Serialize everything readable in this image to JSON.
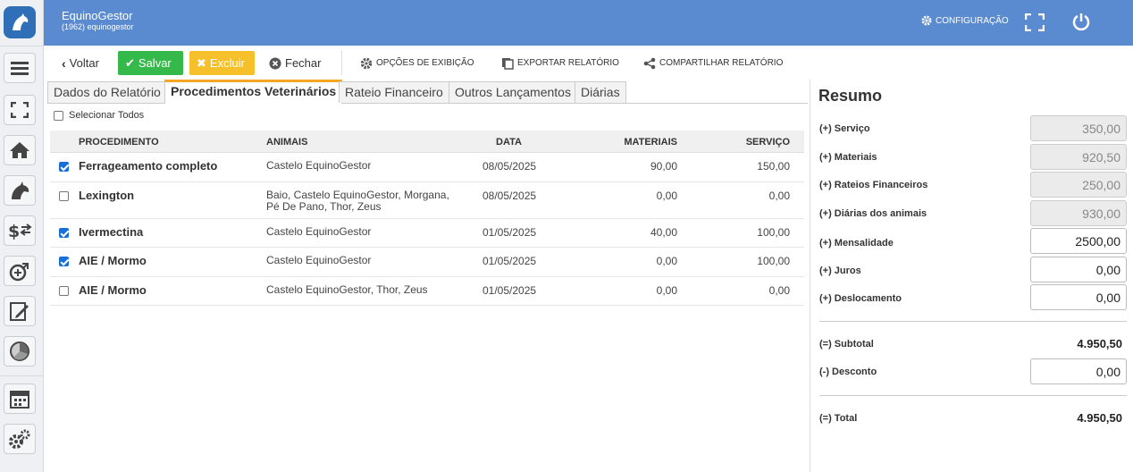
{
  "app": {
    "title": "EquinoGestor",
    "subtitle": "(1962) equinogestor"
  },
  "header": {
    "config_label": "CONFIGURAÇÃO"
  },
  "toolbar": {
    "back": "Voltar",
    "save": "Salvar",
    "delete": "Excluir",
    "close": "Fechar",
    "display_options": "OPÇÕES DE EXIBIÇÃO",
    "export": "EXPORTAR RELATÓRIO",
    "share": "COMPARTILHAR RELATÓRIO"
  },
  "tabs": [
    {
      "label": "Dados do Relatório"
    },
    {
      "label": "Procedimentos Veterinários"
    },
    {
      "label": "Rateio Financeiro"
    },
    {
      "label": "Outros Lançamentos"
    },
    {
      "label": "Diárias"
    }
  ],
  "active_tab": 1,
  "select_all": "Selecionar Todos",
  "table": {
    "columns": [
      "PROCEDIMENTO",
      "ANIMAIS",
      "DATA",
      "MATERIAIS",
      "SERVIÇO"
    ],
    "rows": [
      {
        "checked": true,
        "procedimento": "Ferrageamento completo",
        "animais": "Castelo EquinoGestor",
        "data": "08/05/2025",
        "materiais": "90,00",
        "servico": "150,00"
      },
      {
        "checked": false,
        "procedimento": "Lexington",
        "animais": "Baio, Castelo EquinoGestor, Morgana, Pé De Pano, Thor, Zeus",
        "data": "08/05/2025",
        "materiais": "0,00",
        "servico": "0,00"
      },
      {
        "checked": true,
        "procedimento": "Ivermectina",
        "animais": "Castelo EquinoGestor",
        "data": "01/05/2025",
        "materiais": "40,00",
        "servico": "100,00"
      },
      {
        "checked": true,
        "procedimento": "AIE / Mormo",
        "animais": "Castelo EquinoGestor",
        "data": "01/05/2025",
        "materiais": "0,00",
        "servico": "100,00"
      },
      {
        "checked": false,
        "procedimento": "AIE / Mormo",
        "animais": "Castelo EquinoGestor, Thor, Zeus",
        "data": "01/05/2025",
        "materiais": "0,00",
        "servico": "0,00"
      }
    ]
  },
  "summary": {
    "title": "Resumo",
    "servico": {
      "label": "(+) Serviço",
      "value": "350,00"
    },
    "materiais": {
      "label": "(+) Materiais",
      "value": "920,50"
    },
    "rateios": {
      "label": "(+) Rateios Financeiros",
      "value": "250,00"
    },
    "diarias": {
      "label": "(+) Diárias dos animais",
      "value": "930,00"
    },
    "mensalidade": {
      "label": "(+) Mensalidade",
      "value": "2500,00"
    },
    "juros": {
      "label": "(+) Juros",
      "value": "0,00"
    },
    "deslocamento": {
      "label": "(+) Deslocamento",
      "value": "0,00"
    },
    "subtotal": {
      "label": "(=) Subtotal",
      "value": "4.950,50"
    },
    "desconto": {
      "label": "(-) Desconto",
      "value": "0,00"
    },
    "total": {
      "label": "(=) Total",
      "value": "4.950,50"
    }
  },
  "colors": {
    "header": "#5a8bd0",
    "save": "#34b94a",
    "delete": "#f6c02b",
    "active_tab": "#f5a623",
    "checkbox": "#1a6ed8"
  },
  "sidebar_icons": [
    "menu-icon",
    "fullscreen-icon",
    "home-icon",
    "horse-icon",
    "finance-icon",
    "add-procedure-icon",
    "edit-report-icon",
    "chart-icon",
    "calendar-icon",
    "settings-icon"
  ]
}
